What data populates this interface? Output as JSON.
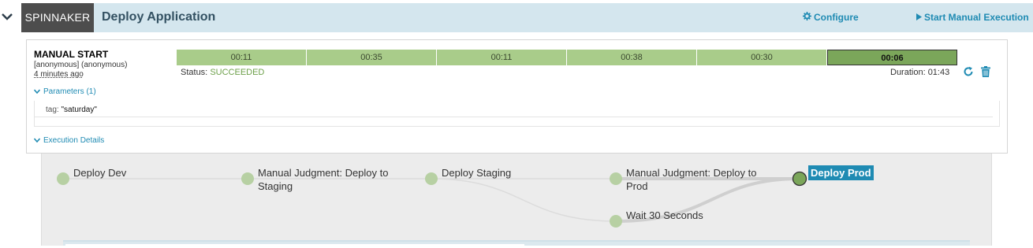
{
  "header": {
    "app_badge": "SPINNAKER",
    "title": "Deploy Application",
    "configure_label": "Configure",
    "manual_label": "Start Manual Execution",
    "accent_color": "#1f8bb3"
  },
  "execution": {
    "trigger_title": "MANUAL START",
    "trigger_user": "[anonymous] (anonymous)",
    "trigger_time": "4 minutes ago",
    "stages": [
      "00:11",
      "00:35",
      "00:11",
      "00:38",
      "00:30",
      "00:06"
    ],
    "status_label": "Status:",
    "status_value": "SUCCEEDED",
    "duration": "Duration: 01:43",
    "parameters_toggle": "Parameters (1)",
    "param_key": "tag:",
    "param_value": "\"saturday\"",
    "details_toggle": "Execution Details"
  },
  "graph": {
    "nodes": [
      {
        "label": "Deploy Dev"
      },
      {
        "label": "Manual Judgment: Deploy to Staging"
      },
      {
        "label": "Deploy Staging"
      },
      {
        "label": "Manual Judgment: Deploy to Prod"
      },
      {
        "label": "Wait 30 Seconds"
      },
      {
        "label": "Deploy Prod"
      }
    ]
  }
}
